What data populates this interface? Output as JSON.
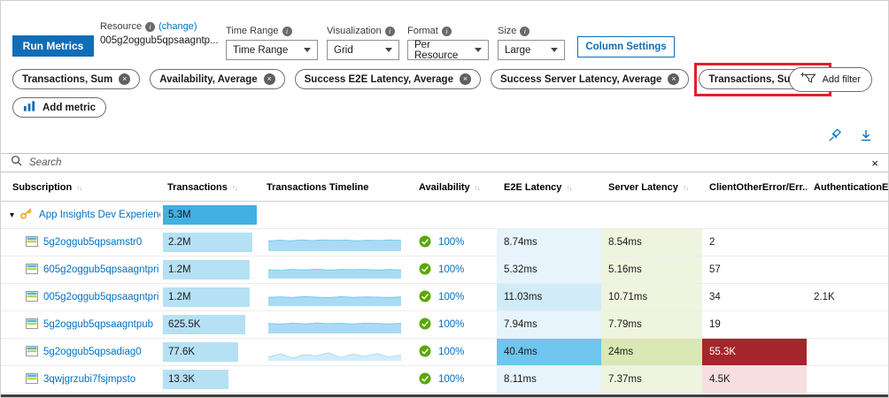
{
  "toolbar": {
    "run_button": "Run Metrics",
    "resource_label": "Resource",
    "resource_change": "(change)",
    "resource_value": "005g2oggub5qpsaagntp...",
    "time_range_label": "Time Range",
    "time_range_value": "Time Range",
    "visualization_label": "Visualization",
    "visualization_value": "Grid",
    "format_label": "Format",
    "format_value": "Per Resource",
    "size_label": "Size",
    "size_value": "Large",
    "column_settings": "Column Settings",
    "add_filter": "Add filter",
    "add_metric": "Add metric"
  },
  "icons": {
    "info": "i",
    "remove": "×",
    "close": "×",
    "sort": "↑↓",
    "expander": "▾"
  },
  "search": {
    "placeholder": "Search"
  },
  "pills": [
    {
      "label": "Transactions, Sum",
      "highlighted": false
    },
    {
      "label": "Availability, Average",
      "highlighted": false
    },
    {
      "label": "Success E2E Latency, Average",
      "highlighted": false
    },
    {
      "label": "Success Server Latency, Average",
      "highlighted": false
    },
    {
      "label": "Transactions, Sum",
      "highlighted": true
    }
  ],
  "table": {
    "columns": [
      {
        "label": "Subscription",
        "sortable": true
      },
      {
        "label": "Transactions",
        "sortable": true
      },
      {
        "label": "Transactions Timeline",
        "sortable": false
      },
      {
        "label": "Availability",
        "sortable": true
      },
      {
        "label": "E2E Latency",
        "sortable": true
      },
      {
        "label": "Server Latency",
        "sortable": true
      },
      {
        "label": "ClientOtherError/Err...",
        "sortable": true
      },
      {
        "label": "AuthenticationErr...",
        "sortable": true
      }
    ],
    "group": {
      "name": "App Insights Dev Experience",
      "transactions": "5.3M",
      "bar_pct": 100
    },
    "rows": [
      {
        "name": "5g2oggub5qpsamstr0",
        "transactions": "2.2M",
        "bar_pct": 95,
        "spark": [
          58,
          62,
          59,
          63,
          60,
          64,
          61,
          63,
          59,
          62,
          60,
          63,
          61
        ],
        "spark_light": false,
        "availability": "100%",
        "e2e": "8.74ms",
        "e2e_heat": "blue-low",
        "server": "8.54ms",
        "server_heat": "green-low",
        "client_err": "2",
        "client_heat": "",
        "auth_err": ""
      },
      {
        "name": "605g2oggub5qpsaagntpri",
        "transactions": "1.2M",
        "bar_pct": 92,
        "spark": [
          50,
          47,
          52,
          49,
          53,
          48,
          51,
          50,
          52,
          48,
          51,
          49
        ],
        "spark_light": false,
        "availability": "100%",
        "e2e": "5.32ms",
        "e2e_heat": "blue-low",
        "server": "5.16ms",
        "server_heat": "green-low",
        "client_err": "57",
        "client_heat": "",
        "auth_err": ""
      },
      {
        "name": "005g2oggub5qpsaagntpri",
        "transactions": "1.2M",
        "bar_pct": 92,
        "spark": [
          49,
          52,
          48,
          54,
          50,
          47,
          53,
          49,
          51,
          50,
          48,
          52
        ],
        "spark_light": false,
        "availability": "100%",
        "e2e": "11.03ms",
        "e2e_heat": "blue-mid",
        "server": "10.71ms",
        "server_heat": "green-low",
        "client_err": "34",
        "client_heat": "",
        "auth_err": "2.1K"
      },
      {
        "name": "5g2oggub5qpsaagntpub",
        "transactions": "625.5K",
        "bar_pct": 88,
        "spark": [
          56,
          53,
          58,
          54,
          59,
          55,
          57,
          53,
          58,
          56,
          54,
          57
        ],
        "spark_light": false,
        "availability": "100%",
        "e2e": "7.94ms",
        "e2e_heat": "blue-low",
        "server": "7.79ms",
        "server_heat": "green-low",
        "client_err": "19",
        "client_heat": "",
        "auth_err": ""
      },
      {
        "name": "5g2oggub5qpsadiag0",
        "transactions": "77.6K",
        "bar_pct": 80,
        "spark": [
          22,
          40,
          15,
          35,
          28,
          45,
          18,
          38,
          25,
          42,
          20,
          33
        ],
        "spark_light": true,
        "availability": "100%",
        "e2e": "40.4ms",
        "e2e_heat": "blue-high",
        "server": "24ms",
        "server_heat": "green-mid",
        "client_err": "55.3K",
        "client_heat": "high",
        "auth_err": ""
      },
      {
        "name": "3qwjgrzubi7fsjmpsto",
        "transactions": "13.3K",
        "bar_pct": 70,
        "spark": [],
        "spark_light": false,
        "availability": "100%",
        "e2e": "8.11ms",
        "e2e_heat": "blue-low",
        "server": "7.37ms",
        "server_heat": "green-low",
        "client_err": "4.5K",
        "client_heat": "low",
        "auth_err": ""
      }
    ]
  },
  "colors": {
    "accent": "#116db6",
    "link": "#0072c6",
    "bar_group": "#41b0e3",
    "bar_row": "#b6e1f4",
    "spark_fill": "#a9dcf4",
    "spark_line": "#7cc8ec",
    "spark_light": "#d4edfa",
    "heat_blue_low": "#e7f4fc",
    "heat_blue_mid": "#d2ebf9",
    "heat_blue_high": "#6fc5ee",
    "heat_green_low": "#eff4de",
    "heat_green_mid": "#d9e8b4",
    "err_high": "#a4262c",
    "err_low": "#f7dee0",
    "check_green": "#5aa700",
    "annotation_red": "#e22128"
  }
}
